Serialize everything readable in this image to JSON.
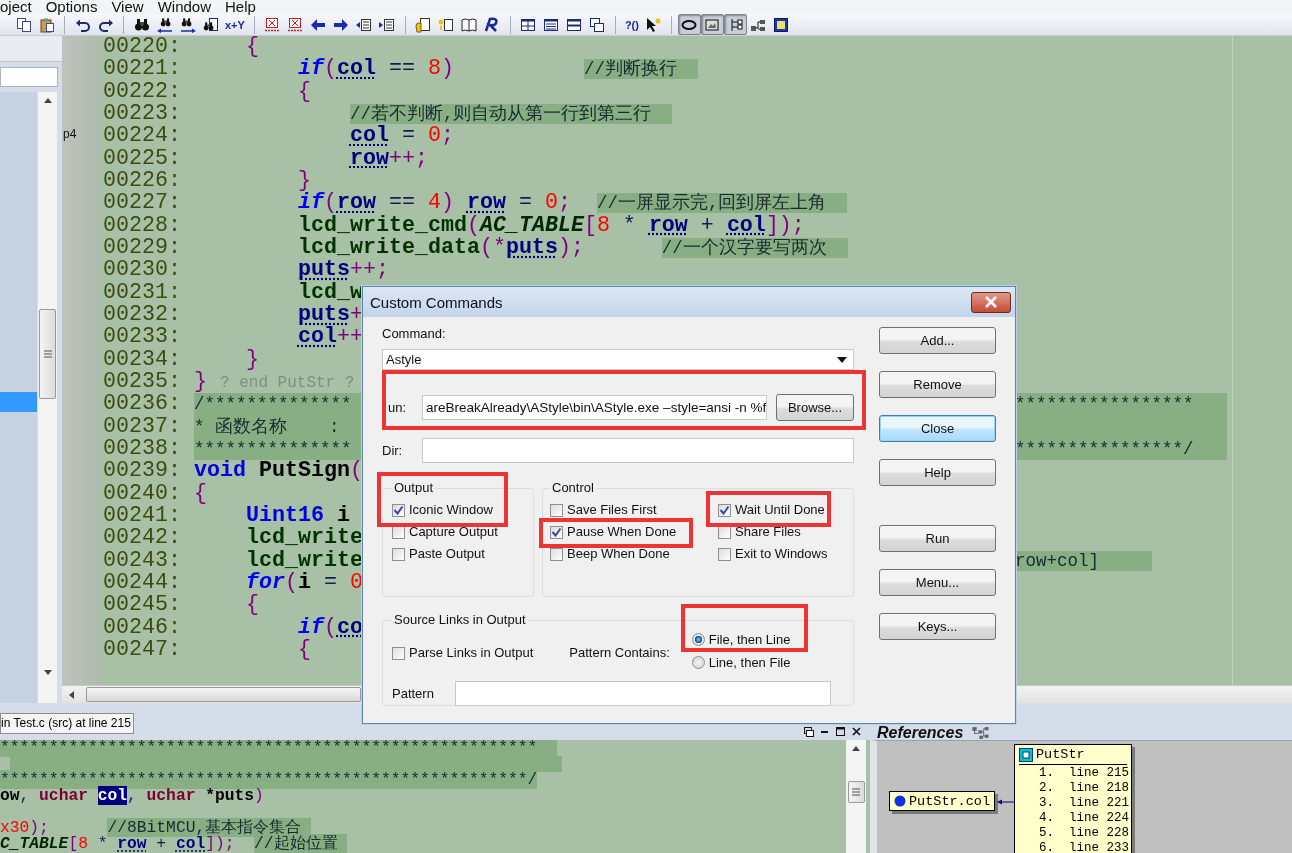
{
  "menu": [
    {
      "label": "oject"
    },
    {
      "label": "Options"
    },
    {
      "label": "View"
    },
    {
      "label": "Window"
    },
    {
      "label": "Help"
    }
  ],
  "toolbar": [
    [
      {
        "pressed": false
      },
      {
        "pressed": false
      }
    ],
    [
      {
        "pressed": false
      },
      {
        "pressed": false
      }
    ],
    [
      {
        "pressed": false
      },
      {
        "pressed": false
      },
      {
        "pressed": false
      },
      {
        "pressed": false
      },
      {
        "pressed": false,
        "label": "x+Y"
      }
    ],
    [
      {
        "pressed": false
      },
      {
        "pressed": false
      },
      {
        "pressed": false
      },
      {
        "pressed": false
      },
      {
        "pressed": false
      },
      {
        "pressed": false
      }
    ],
    [
      {
        "pressed": false
      },
      {
        "pressed": false
      },
      {
        "pressed": false
      },
      {
        "pressed": false
      }
    ],
    [
      {
        "pressed": false
      },
      {
        "pressed": false
      },
      {
        "pressed": false
      },
      {
        "pressed": false
      }
    ],
    [
      {
        "pressed": false,
        "label": "?()"
      },
      {
        "pressed": false
      }
    ],
    [
      {
        "pressed": true
      },
      {
        "pressed": true
      },
      {
        "pressed": true
      },
      {
        "pressed": false
      },
      {
        "pressed": false
      }
    ]
  ],
  "left_panel": {
    "rows": [
      {
        "selected": false
      },
      {
        "selected": false
      },
      {
        "selected": false
      },
      {
        "selected": false
      },
      {
        "selected": false
      },
      {
        "selected": false
      },
      {
        "selected": false
      },
      {
        "selected": false
      },
      {
        "selected": false
      },
      {
        "selected": false
      },
      {
        "selected": false
      },
      {
        "selected": false
      },
      {
        "selected": false
      },
      {
        "selected": false
      },
      {
        "selected": false
      },
      {
        "selected": true
      }
    ]
  },
  "editor": {
    "lines": [
      {
        "number": "00220:",
        "highlight": false,
        "tokens": [
          {
            "kind": "u",
            "text": "    {"
          }
        ]
      },
      {
        "number": "00221:",
        "highlight": false,
        "tokens": [
          {
            "kind": "k",
            "text": "        if"
          },
          {
            "kind": "u",
            "text": "("
          },
          {
            "kind": "v",
            "text": "col"
          },
          {
            "kind": "o",
            "text": " == "
          },
          {
            "kind": "n",
            "text": "8"
          },
          {
            "kind": "u",
            "text": ")          "
          },
          {
            "kind": "c",
            "text": "//判断换行  "
          }
        ]
      },
      {
        "number": "00222:",
        "highlight": false,
        "tokens": [
          {
            "kind": "u",
            "text": "        {"
          }
        ]
      },
      {
        "number": "00223:",
        "highlight": false,
        "tokens": [
          {
            "kind": "c",
            "text": "            //若不判断,则自动从第一行到第三行  "
          }
        ]
      },
      {
        "number": "00224:",
        "mark": "p4",
        "highlight": false,
        "tokens": [
          {
            "kind": "v",
            "text": "            col"
          },
          {
            "kind": "o",
            "text": " = "
          },
          {
            "kind": "n",
            "text": "0"
          },
          {
            "kind": "u",
            "text": ";"
          }
        ]
      },
      {
        "number": "00225:",
        "highlight": false,
        "tokens": [
          {
            "kind": "v",
            "text": "            row"
          },
          {
            "kind": "u",
            "text": "++;"
          }
        ]
      },
      {
        "number": "00226:",
        "highlight": false,
        "tokens": [
          {
            "kind": "u",
            "text": "        }"
          }
        ]
      },
      {
        "number": "00227:",
        "highlight": false,
        "tokens": [
          {
            "kind": "k",
            "text": "        if"
          },
          {
            "kind": "u",
            "text": "("
          },
          {
            "kind": "v",
            "text": "row"
          },
          {
            "kind": "o",
            "text": " == "
          },
          {
            "kind": "n",
            "text": "4"
          },
          {
            "kind": "u",
            "text": ") "
          },
          {
            "kind": "v",
            "text": "row"
          },
          {
            "kind": "o",
            "text": " = "
          },
          {
            "kind": "n",
            "text": "0"
          },
          {
            "kind": "u",
            "text": ";  "
          },
          {
            "kind": "c",
            "text": "//一屏显示完,回到屏左上角  "
          }
        ]
      },
      {
        "number": "00228:",
        "highlight": false,
        "tokens": [
          {
            "kind": "f",
            "text": "        lcd_write_cmd"
          },
          {
            "kind": "u",
            "text": "("
          },
          {
            "kind": "m",
            "text": "AC_TABLE"
          },
          {
            "kind": "u",
            "text": "["
          },
          {
            "kind": "n",
            "text": "8"
          },
          {
            "kind": "o",
            "text": " * "
          },
          {
            "kind": "v",
            "text": "row"
          },
          {
            "kind": "o",
            "text": " + "
          },
          {
            "kind": "v",
            "text": "col"
          },
          {
            "kind": "u",
            "text": "]);"
          }
        ]
      },
      {
        "number": "00229:",
        "highlight": false,
        "tokens": [
          {
            "kind": "f",
            "text": "        lcd_write_data"
          },
          {
            "kind": "u",
            "text": "(*"
          },
          {
            "kind": "v",
            "text": "puts"
          },
          {
            "kind": "u",
            "text": ");      "
          },
          {
            "kind": "c",
            "text": "//一个汉字要写两次  "
          }
        ]
      },
      {
        "number": "00230:",
        "highlight": false,
        "tokens": [
          {
            "kind": "v",
            "text": "        puts"
          },
          {
            "kind": "u",
            "text": "++;"
          }
        ]
      },
      {
        "number": "00231:",
        "highlight": false,
        "tokens": [
          {
            "kind": "f",
            "text": "        lcd_w"
          }
        ]
      },
      {
        "number": "00232:",
        "highlight": false,
        "tokens": [
          {
            "kind": "v",
            "text": "        puts"
          },
          {
            "kind": "u",
            "text": "+"
          }
        ]
      },
      {
        "number": "00233:",
        "highlight": false,
        "tokens": [
          {
            "kind": "v",
            "text": "        col"
          },
          {
            "kind": "u",
            "text": "++"
          }
        ]
      },
      {
        "number": "00234:",
        "highlight": false,
        "tokens": [
          {
            "kind": "u",
            "text": "    }"
          }
        ]
      },
      {
        "number": "00235:",
        "highlight": false,
        "tokens": [
          {
            "kind": "u",
            "text": "} "
          },
          {
            "kind": "g",
            "text": "? end PutStr ?"
          }
        ]
      },
      {
        "number": "00236:",
        "highlight": true,
        "tokens": [
          {
            "kind": "c",
            "text": "/**************"
          }
        ],
        "tail": [
          {
            "kind": "c",
            "text": "*****************"
          }
        ]
      },
      {
        "number": "00237:",
        "highlight": true,
        "tokens": [
          {
            "kind": "c",
            "text": "* 函数名称    :"
          }
        ]
      },
      {
        "number": "00238:",
        "highlight": true,
        "tokens": [
          {
            "kind": "c",
            "text": "***************"
          }
        ],
        "tail": [
          {
            "kind": "c",
            "text": "****************/"
          }
        ]
      },
      {
        "number": "00239:",
        "highlight": false,
        "tokens": [
          {
            "kind": "t",
            "text": "void"
          },
          {
            "kind": "b",
            "text": " PutSign"
          },
          {
            "kind": "u",
            "text": "("
          }
        ]
      },
      {
        "number": "00240:",
        "highlight": false,
        "tokens": [
          {
            "kind": "u",
            "text": "{"
          }
        ]
      },
      {
        "number": "00241:",
        "highlight": false,
        "tokens": [
          {
            "kind": "t",
            "text": "    Uint16"
          },
          {
            "kind": "b",
            "text": " i"
          }
        ]
      },
      {
        "number": "00242:",
        "highlight": false,
        "tokens": [
          {
            "kind": "f",
            "text": "    lcd_write"
          }
        ]
      },
      {
        "number": "00243:",
        "highlight": false,
        "tokens": [
          {
            "kind": "f",
            "text": "    lcd_write"
          }
        ],
        "tail": [
          {
            "kind": "c",
            "text": "row+col]     "
          }
        ]
      },
      {
        "number": "00244:",
        "highlight": false,
        "tokens": [
          {
            "kind": "k",
            "text": "    for"
          },
          {
            "kind": "u",
            "text": "("
          },
          {
            "kind": "b",
            "text": "i"
          },
          {
            "kind": "o",
            "text": " = "
          },
          {
            "kind": "n",
            "text": "0"
          }
        ]
      },
      {
        "number": "00245:",
        "highlight": false,
        "tokens": [
          {
            "kind": "u",
            "text": "    {"
          }
        ]
      },
      {
        "number": "00246:",
        "highlight": false,
        "tokens": [
          {
            "kind": "k",
            "text": "        if"
          },
          {
            "kind": "u",
            "text": "("
          },
          {
            "kind": "v",
            "text": "co"
          }
        ]
      },
      {
        "number": "00247:",
        "highlight": false,
        "tokens": [
          {
            "kind": "u",
            "text": "        {"
          }
        ]
      }
    ]
  },
  "bottom_panel": {
    "tab": "in Test.c (src) at line 215",
    "lines": [
      {
        "highlight": false,
        "tokens": [
          {
            "kind": "c",
            "text": "*******************************************************  "
          }
        ]
      },
      {
        "highlight": true
      },
      {
        "highlight": false,
        "tokens": [
          {
            "kind": "c",
            "text": "******************************************************/"
          }
        ]
      },
      {
        "highlight": false,
        "tokens": [
          {
            "kind": "b",
            "text": "ow"
          },
          {
            "kind": "o",
            "text": ", "
          },
          {
            "kind": "r",
            "text": "uchar "
          },
          {
            "kind": "s",
            "text": "col"
          },
          {
            "kind": "o",
            "text": ", "
          },
          {
            "kind": "r",
            "text": "uchar"
          },
          {
            "kind": "b",
            "text": " *puts"
          },
          {
            "kind": "u",
            "text": ")"
          }
        ]
      },
      {
        "highlight": false
      },
      {
        "highlight": false,
        "tokens": [
          {
            "kind": "n",
            "text": "x30"
          },
          {
            "kind": "u",
            "text": ");      "
          },
          {
            "kind": "c",
            "text": "//8BitMCU,基本指令集合 "
          }
        ]
      },
      {
        "highlight": false,
        "tokens": [
          {
            "kind": "m",
            "text": "C_TABLE"
          },
          {
            "kind": "u",
            "text": "["
          },
          {
            "kind": "n",
            "text": "8"
          },
          {
            "kind": "o",
            "text": " * "
          },
          {
            "kind": "v",
            "text": "row"
          },
          {
            "kind": "o",
            "text": " + "
          },
          {
            "kind": "v",
            "text": "col"
          },
          {
            "kind": "u",
            "text": "]);  "
          },
          {
            "kind": "c",
            "text": "//起始位置 "
          }
        ]
      }
    ]
  },
  "references": {
    "title": "References",
    "source": "PutStr.col",
    "target": {
      "title": "PutStr",
      "items": [
        "1.  line 215",
        "2.  line 218",
        "3.  line 221",
        "4.  line 224",
        "5.  line 228",
        "6.  line 233"
      ]
    }
  },
  "dialog": {
    "title": "Custom Commands",
    "command_label": "Command:",
    "command": "Astyle",
    "run": {
      "label": "un:",
      "value": "areBreakAlready\\AStyle\\bin\\AStyle.exe –style=ansi -n %f",
      "framed": true
    },
    "browse": "Browse...",
    "dir_label": "Dir:",
    "output": {
      "legend": "Output",
      "options": [
        {
          "label": "Iconic Window",
          "checked": true,
          "framed": true
        },
        {
          "label": "Capture Output",
          "checked": false,
          "framed": false
        },
        {
          "label": "Paste Output",
          "checked": false,
          "framed": false
        }
      ]
    },
    "control": {
      "legend": "Control",
      "options": [
        {
          "label": "Save Files First",
          "checked": false,
          "framed": false
        },
        {
          "label": "Pause When Done",
          "checked": true,
          "framed": true
        },
        {
          "label": "Beep When Done",
          "checked": false,
          "framed": false
        },
        {
          "label": "Wait Until Done",
          "checked": true,
          "framed": true
        },
        {
          "label": "Share Files",
          "checked": false,
          "framed": false
        },
        {
          "label": "Exit to Windows",
          "checked": false,
          "framed": false
        }
      ]
    },
    "source_links": {
      "legend": "Source Links in Output",
      "parse": {
        "label": "Parse Links in Output",
        "checked": false
      },
      "pattern_contains_label": "Pattern Contains:",
      "pattern_options": [
        {
          "label": "File, then Line",
          "selected": true,
          "framed": true
        },
        {
          "label": "Line, then File",
          "selected": false,
          "framed": false
        }
      ],
      "pattern_label": "Pattern"
    },
    "buttons": [
      {
        "label": "Add...",
        "focused": false
      },
      {
        "label": "Remove",
        "focused": false
      },
      {
        "label": "Close",
        "focused": true
      },
      {
        "label": "Help",
        "focused": false
      },
      {
        "label": "Run",
        "focused": false
      },
      {
        "label": "Menu...",
        "focused": false
      },
      {
        "label": "Keys...",
        "focused": false
      }
    ]
  }
}
